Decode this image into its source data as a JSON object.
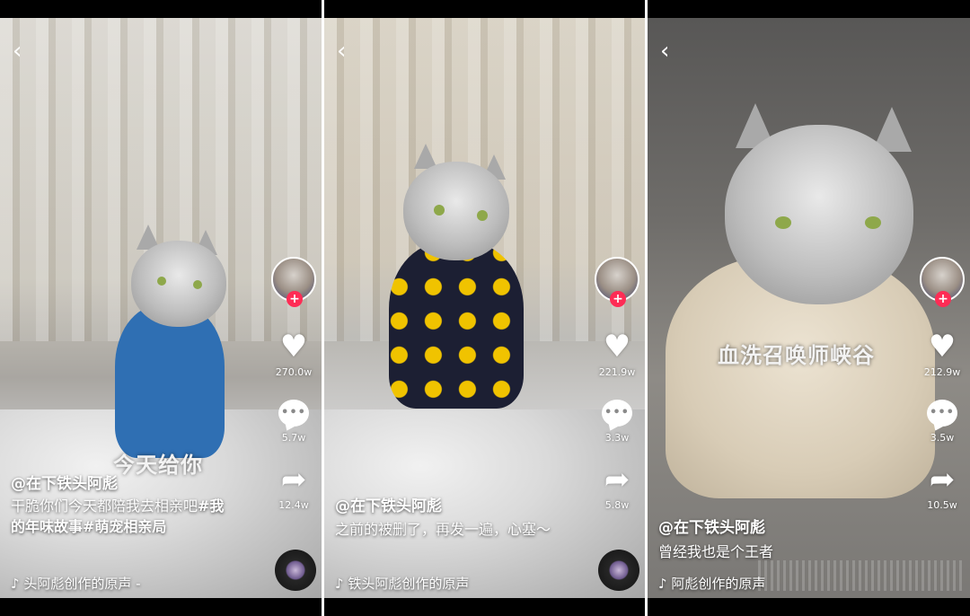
{
  "panels": [
    {
      "author": "@在下铁头阿彪",
      "caption_parts": [
        "干脆你们今天都陪我去相亲吧",
        "#我的年味故事#萌宠相亲局"
      ],
      "music": "♪ 头阿彪创作的原声 -",
      "likes": "270.0w",
      "comments": "5.7w",
      "shares": "12.4w",
      "overlay_text": "今天给你"
    },
    {
      "author": "@在下铁头阿彪",
      "caption_parts": [
        "之前的被删了，再发一遍，心塞～",
        ""
      ],
      "music": "♪ 铁头阿彪创作的原声",
      "likes": "221.9w",
      "comments": "3.3w",
      "shares": "5.8w",
      "overlay_text": ""
    },
    {
      "author": "@在下铁头阿彪",
      "caption_parts": [
        "曾经我也是个王者",
        ""
      ],
      "music": "♪ 阿彪创作的原声",
      "likes": "212.9w",
      "comments": "3.5w",
      "shares": "10.5w",
      "overlay_text": "血洗召唤师峡谷"
    }
  ],
  "icons": {
    "back": "chevron-left-icon",
    "like": "heart-icon",
    "comment": "comment-icon",
    "share": "share-icon",
    "follow": "plus-icon"
  },
  "colors": {
    "follow_badge": "#fe2c55",
    "text": "#ffffff"
  }
}
